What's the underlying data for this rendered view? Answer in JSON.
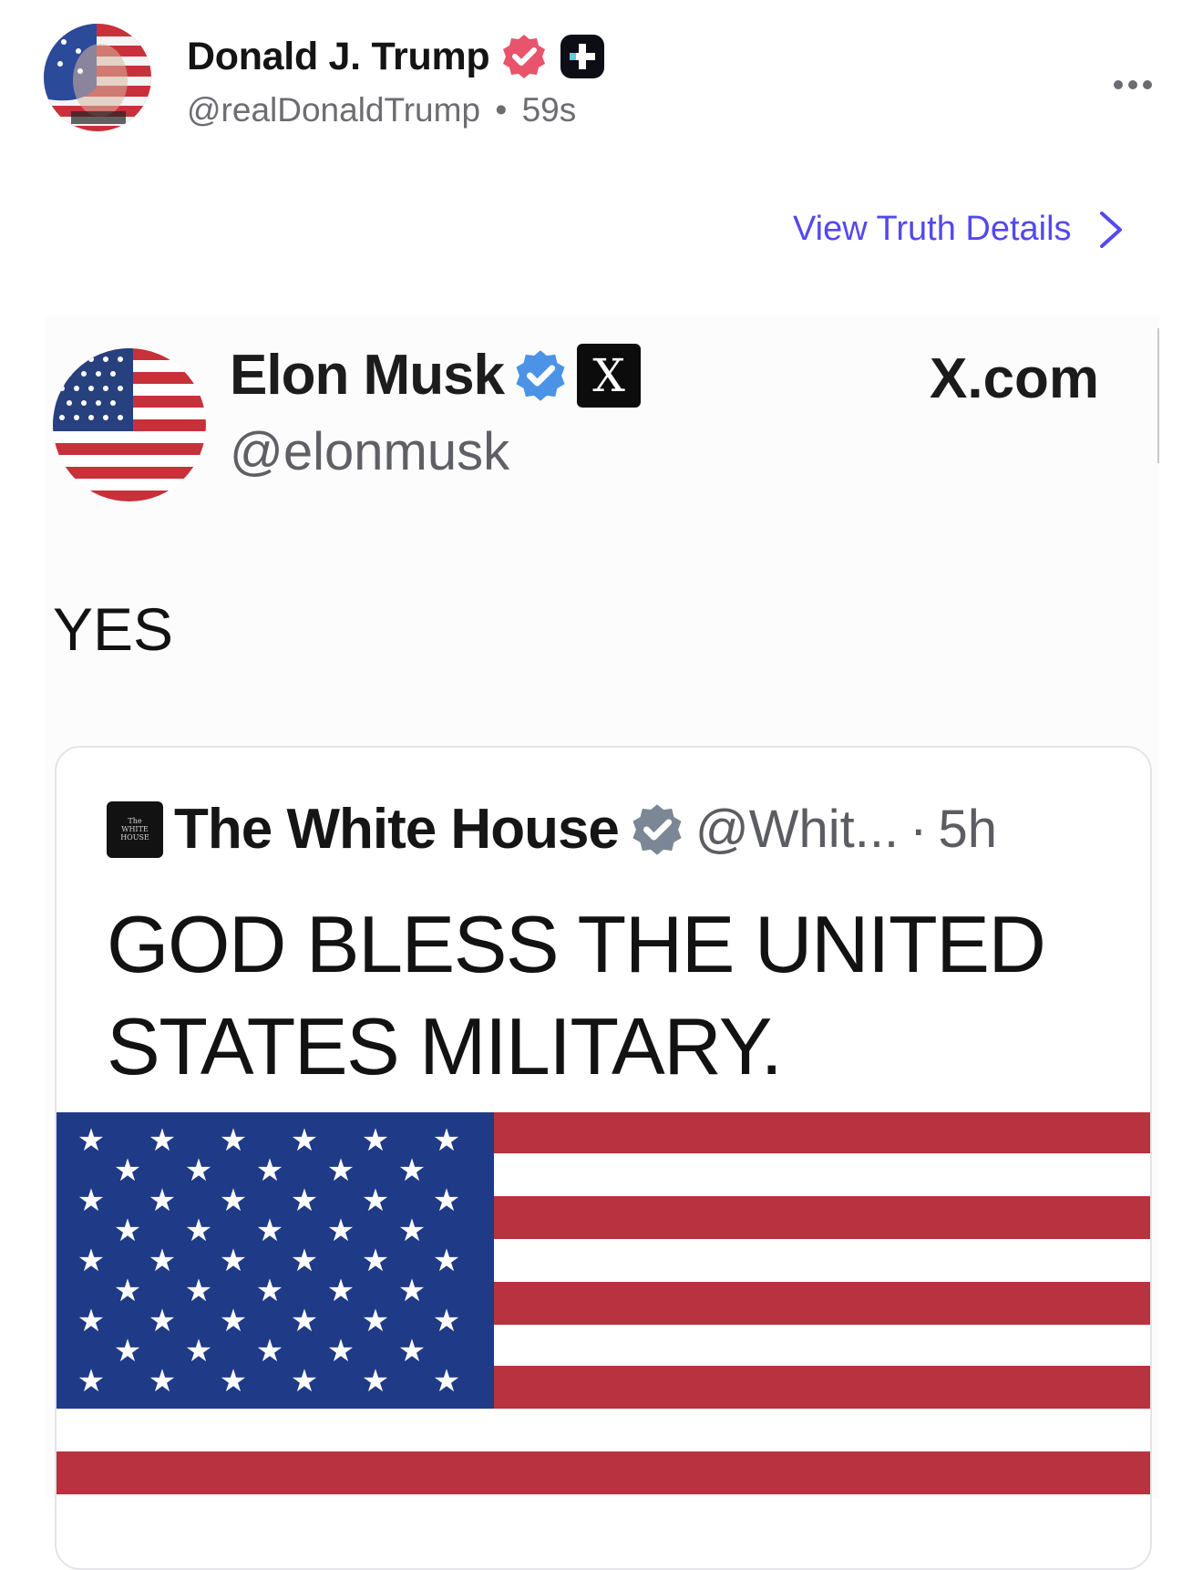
{
  "post": {
    "author_name": "Donald J. Trump",
    "author_handle": "@realDonaldTrump",
    "timestamp": "59s",
    "separator": "•",
    "verified_icon": "verified-badge-icon",
    "plus_icon": "truth-plus-icon",
    "more_icon": "more-dots-icon",
    "view_details_label": "View Truth Details",
    "colors": {
      "link": "#5448ee",
      "badge": "#e8546c",
      "muted": "#6c6c72"
    }
  },
  "embedded": {
    "author_name": "Elon Musk",
    "author_handle": "@elonmusk",
    "x_icon": "X",
    "site_label": "X.com",
    "text": "YES",
    "quoted": {
      "author_name": "The White House",
      "author_handle": "@Whit...",
      "time": "5h",
      "dot": "·",
      "logo_text": [
        "The",
        "WHITE",
        "HOUSE"
      ],
      "text": "GOD BLESS THE UNITED STATES MILITARY."
    }
  }
}
